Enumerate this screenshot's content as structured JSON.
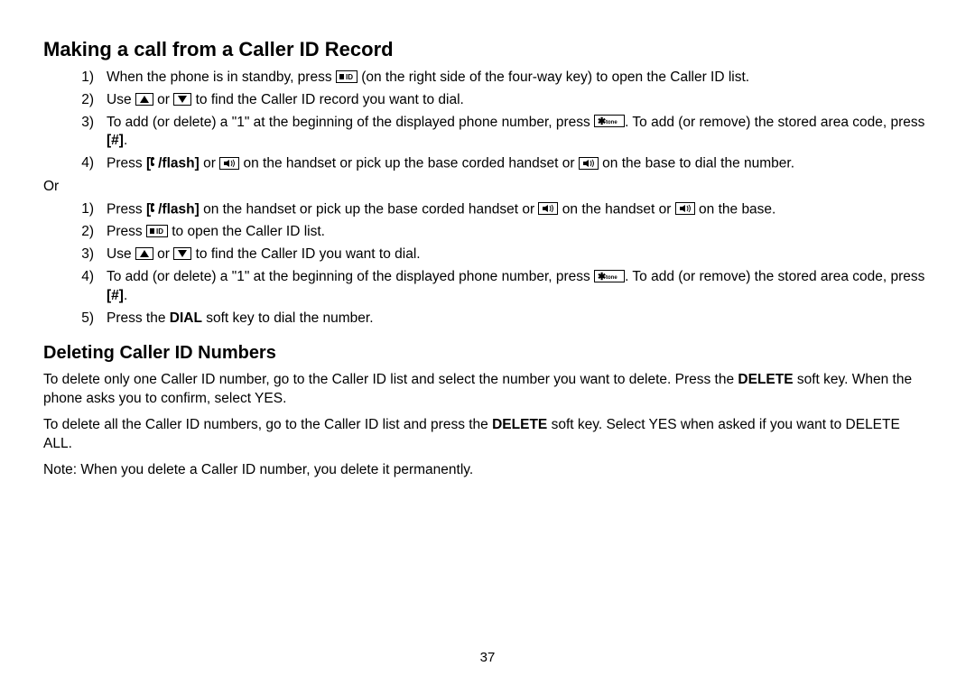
{
  "section1": {
    "title": "Making a call from a Caller ID Record",
    "listA": [
      {
        "n": "1)",
        "parts": [
          {
            "t": "When the phone is in standby, press "
          },
          {
            "icon": "cid"
          },
          {
            "t": " (on the right side of the four-way key) to open the Caller ID list."
          }
        ]
      },
      {
        "n": "2)",
        "parts": [
          {
            "t": "Use "
          },
          {
            "icon": "up"
          },
          {
            "t": " or "
          },
          {
            "icon": "down"
          },
          {
            "t": " to find the Caller ID record you want to dial."
          }
        ]
      },
      {
        "n": "3)",
        "parts": [
          {
            "t": "To add (or delete) a \"1\" at the beginning of the displayed phone number, press "
          },
          {
            "icon": "star-tone"
          },
          {
            "t": ". To add (or remove) the stored area code, press "
          },
          {
            "bold": "[#]"
          },
          {
            "t": "."
          }
        ]
      },
      {
        "n": "4)",
        "parts": [
          {
            "t": "Press "
          },
          {
            "bold": "["
          },
          {
            "icon": "phone-inline"
          },
          {
            "bold": "/flash]"
          },
          {
            "t": " or "
          },
          {
            "icon": "speaker"
          },
          {
            "t": " on the handset or pick up the base corded handset or "
          },
          {
            "icon": "speaker"
          },
          {
            "t": " on the base to dial the number."
          }
        ]
      }
    ],
    "or": "Or",
    "listB": [
      {
        "n": "1)",
        "parts": [
          {
            "t": "Press "
          },
          {
            "bold": "["
          },
          {
            "icon": "phone-inline"
          },
          {
            "bold": "/flash]"
          },
          {
            "t": " on the handset or pick up the base corded handset or "
          },
          {
            "icon": "speaker"
          },
          {
            "t": " on the handset or "
          },
          {
            "icon": "speaker"
          },
          {
            "t": " on the base."
          }
        ]
      },
      {
        "n": "2)",
        "parts": [
          {
            "t": "Press "
          },
          {
            "icon": "cid"
          },
          {
            "t": " to open the Caller ID list."
          }
        ]
      },
      {
        "n": "3)",
        "parts": [
          {
            "t": "Use "
          },
          {
            "icon": "up"
          },
          {
            "t": " or "
          },
          {
            "icon": "down"
          },
          {
            "t": " to find the Caller ID you want to dial."
          }
        ]
      },
      {
        "n": "4)",
        "parts": [
          {
            "t": "To add (or delete) a \"1\" at the beginning of the displayed phone number, press "
          },
          {
            "icon": "star-tone"
          },
          {
            "t": ". To add (or remove) the stored area code, press "
          },
          {
            "bold": "[#]"
          },
          {
            "t": "."
          }
        ]
      },
      {
        "n": "5)",
        "parts": [
          {
            "t": "Press the "
          },
          {
            "bold": "DIAL"
          },
          {
            "t": " soft key to dial the number."
          }
        ]
      }
    ]
  },
  "section2": {
    "title": "Deleting Caller ID Numbers",
    "p1": [
      {
        "t": "To delete only one Caller ID number, go to the Caller ID list and select the number you want to delete. Press the "
      },
      {
        "bold": "DELETE"
      },
      {
        "t": " soft key. When the phone asks you to confirm, select YES."
      }
    ],
    "p2": [
      {
        "t": "To delete all the Caller ID numbers, go to the Caller ID list and press the "
      },
      {
        "bold": "DELETE"
      },
      {
        "t": " soft key. Select YES when asked if you want to DELETE ALL."
      }
    ],
    "p3": [
      {
        "t": "Note: When you delete a Caller ID number, you delete it permanently."
      }
    ]
  },
  "pageNumber": "37"
}
